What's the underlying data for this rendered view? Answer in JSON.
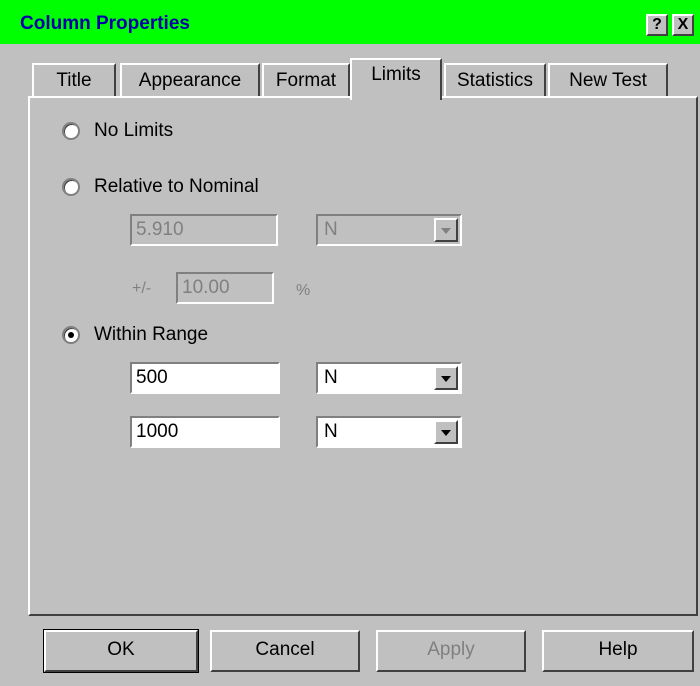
{
  "window": {
    "title": "Column Properties",
    "help_button": "?",
    "close_button": "X",
    "titlebar_color": "#00ff00",
    "title_color": "#0000a8"
  },
  "tabs": [
    {
      "label": "Title",
      "active": false
    },
    {
      "label": "Appearance",
      "active": false
    },
    {
      "label": "Format",
      "active": false
    },
    {
      "label": "Limits",
      "active": true
    },
    {
      "label": "Statistics",
      "active": false
    },
    {
      "label": "New Test",
      "active": false
    }
  ],
  "limits": {
    "no_limits_label": "No Limits",
    "relative_label": "Relative to Nominal",
    "nominal_value": "5.910",
    "nominal_unit": "N",
    "plusminus_label": "+/-",
    "tolerance_value": "10.00",
    "percent_label": "%",
    "within_range_label": "Within Range",
    "selected": "within_range",
    "range_low_value": "500",
    "range_low_unit": "N",
    "range_high_value": "1000",
    "range_high_unit": "N"
  },
  "buttons": {
    "ok": "OK",
    "cancel": "Cancel",
    "apply": "Apply",
    "help": "Help"
  }
}
